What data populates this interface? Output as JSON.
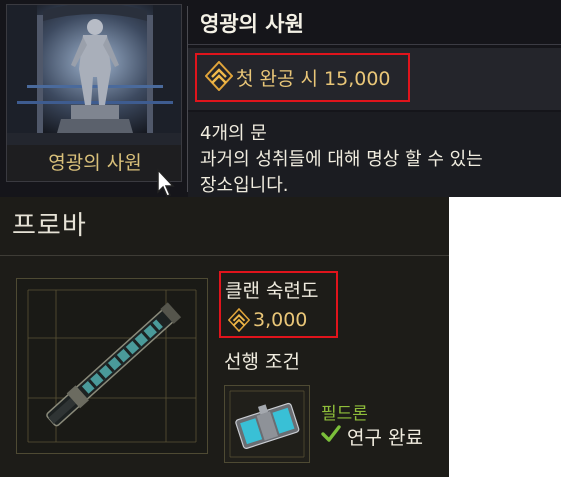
{
  "tooltip": {
    "thumbnail_caption": "영광의 사원",
    "title": "영광의 사원",
    "reward": {
      "icon": "standing-icon",
      "text": "첫 완공 시 15,000"
    },
    "subtitle": "4개의 문",
    "description_lines": [
      "과거의 성취들에 대해 명상 할 수 있는",
      "장소입니다."
    ]
  },
  "item": {
    "name": "프로바",
    "mastery_label": "클랜 숙련도",
    "mastery_icon": "standing-icon",
    "mastery_value": "3,000",
    "prerequisite_label": "선행 조건",
    "prerequisite": {
      "name": "필드론",
      "status_icon": "check-icon",
      "status": "연구 완료"
    }
  },
  "colors": {
    "highlight_border": "#e0141c",
    "gold": "#e9c678",
    "green": "#8fbe3a",
    "caption_gold": "#d9c07a"
  }
}
